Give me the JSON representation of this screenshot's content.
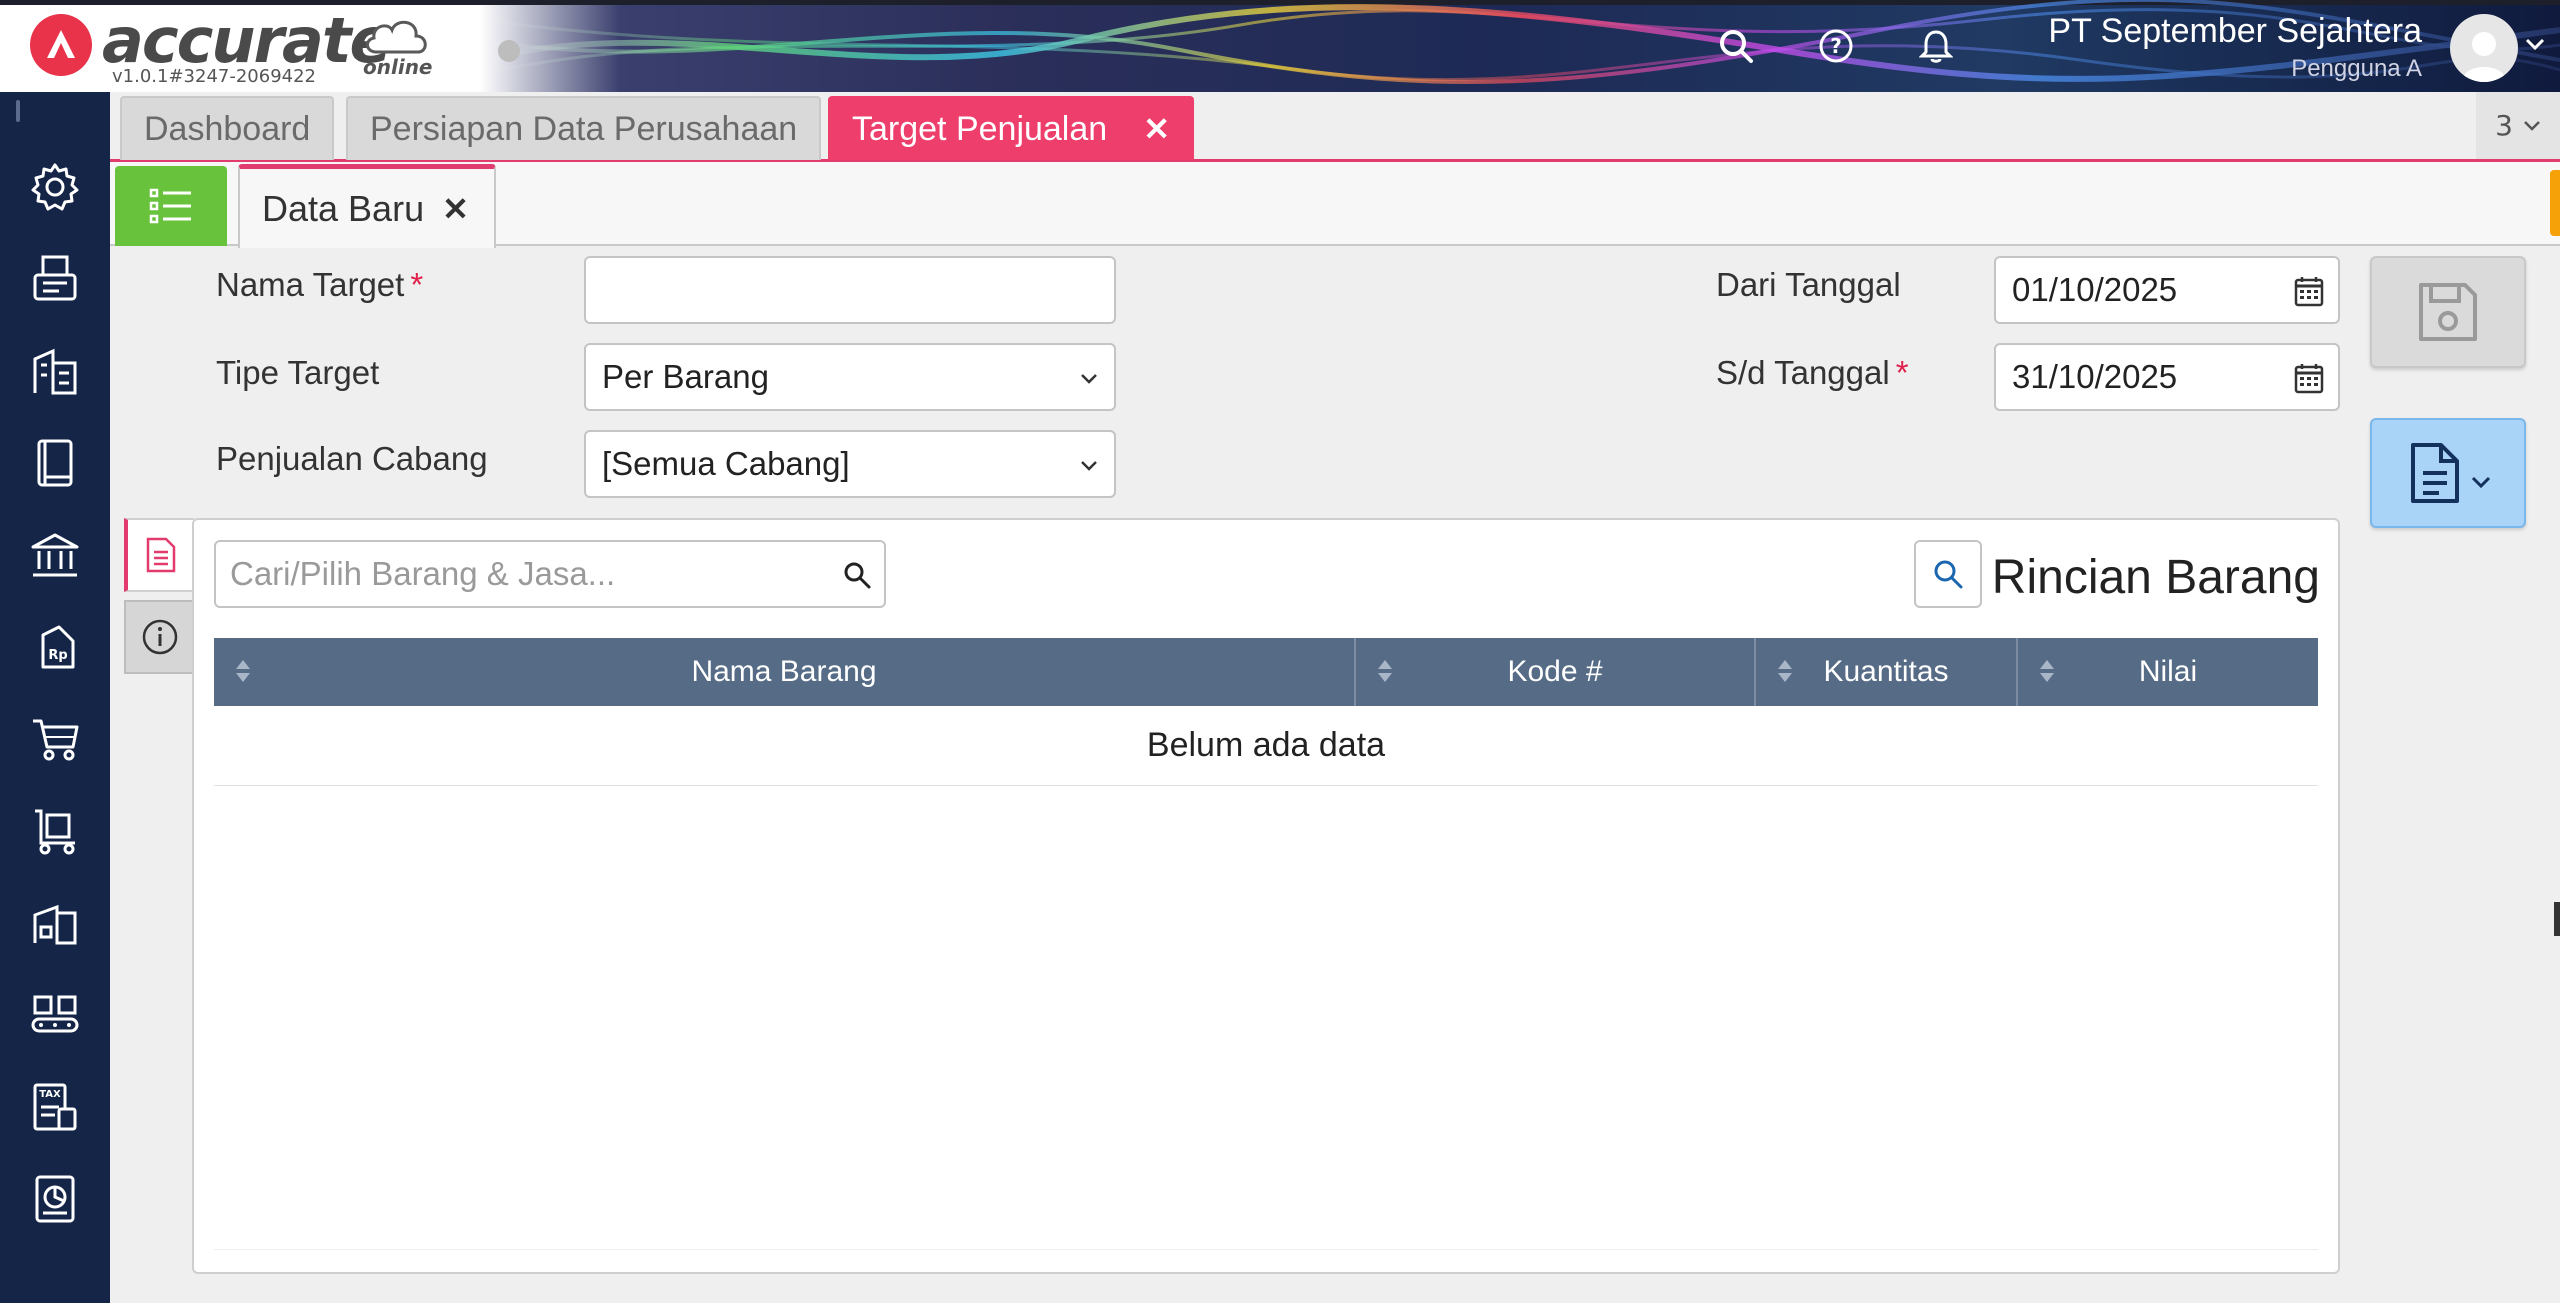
{
  "header": {
    "logo_text": "accurate",
    "logo_sub": "online",
    "version": "v1.0.1#3247-2069422",
    "company_name": "PT September Sejahtera",
    "user_name": "Pengguna A",
    "icons": [
      "search-icon",
      "help-icon",
      "bell-icon",
      "avatar-icon"
    ]
  },
  "sidebar": {
    "items": [
      {
        "name": "settings",
        "icon": "gear-icon"
      },
      {
        "name": "fax",
        "icon": "fax-icon"
      },
      {
        "name": "company",
        "icon": "building-icon"
      },
      {
        "name": "ledger",
        "icon": "book-icon"
      },
      {
        "name": "bank",
        "icon": "bank-icon"
      },
      {
        "name": "sales-tag",
        "icon": "price-tag-icon"
      },
      {
        "name": "sales",
        "icon": "cart-icon"
      },
      {
        "name": "purchase",
        "icon": "trolley-icon"
      },
      {
        "name": "inventory",
        "icon": "warehouse-icon"
      },
      {
        "name": "production",
        "icon": "conveyor-icon"
      },
      {
        "name": "tax",
        "icon": "tax-icon"
      },
      {
        "name": "reports",
        "icon": "report-icon"
      }
    ]
  },
  "tabs": [
    {
      "label": "Dashboard"
    },
    {
      "label": "Persiapan Data Perusahaan"
    },
    {
      "label": "Target Penjualan",
      "close": "✕"
    }
  ],
  "tab_count": "3",
  "subtabs": {
    "active_label": "Data Baru",
    "close": "✕"
  },
  "form": {
    "nama_target_label": "Nama Target",
    "nama_target_value": "",
    "required_mark": "*",
    "tipe_target_label": "Tipe Target",
    "tipe_target_value": "Per Barang",
    "cabang_label": "Penjualan Cabang",
    "cabang_value": "[Semua Cabang]",
    "dari_label": "Dari Tanggal",
    "dari_value": "01/10/2025",
    "sd_label": "S/d Tanggal",
    "sd_value": "31/10/2025"
  },
  "detail": {
    "search_placeholder": "Cari/Pilih Barang & Jasa...",
    "title": "Rincian Barang",
    "columns": [
      "Nama Barang",
      "Kode #",
      "Kuantitas",
      "Nilai"
    ],
    "empty_text": "Belum ada data"
  },
  "colors": {
    "accent": "#ee3e6c",
    "sidebar": "#142548",
    "list_button": "#69c23c",
    "bulb_button": "#f6a107",
    "grid_header": "#566b86"
  }
}
